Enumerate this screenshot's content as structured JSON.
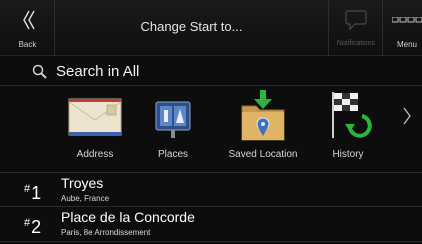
{
  "header": {
    "back_label": "Back",
    "title": "Change Start to...",
    "notifications_label": "Notifications",
    "menu_label": "Menu"
  },
  "search": {
    "label": "Search in All",
    "icon": "magnifier-icon"
  },
  "categories": [
    {
      "label": "Address",
      "icon": "envelope-icon"
    },
    {
      "label": "Places",
      "icon": "places-icon"
    },
    {
      "label": "Saved Location",
      "icon": "folder-pin-icon"
    },
    {
      "label": "History",
      "icon": "checkered-flag-icon"
    }
  ],
  "results": [
    {
      "rank": "1",
      "hash": "#",
      "name": "Troyes",
      "detail": "Aube, France"
    },
    {
      "rank": "2",
      "hash": "#",
      "name": "Place de la Concorde",
      "detail": "Paris, 8e Arrondissement"
    }
  ],
  "colors": {
    "background": "#0d0d0d",
    "accent_green": "#2bb53c",
    "divider": "#2a2a2a"
  }
}
